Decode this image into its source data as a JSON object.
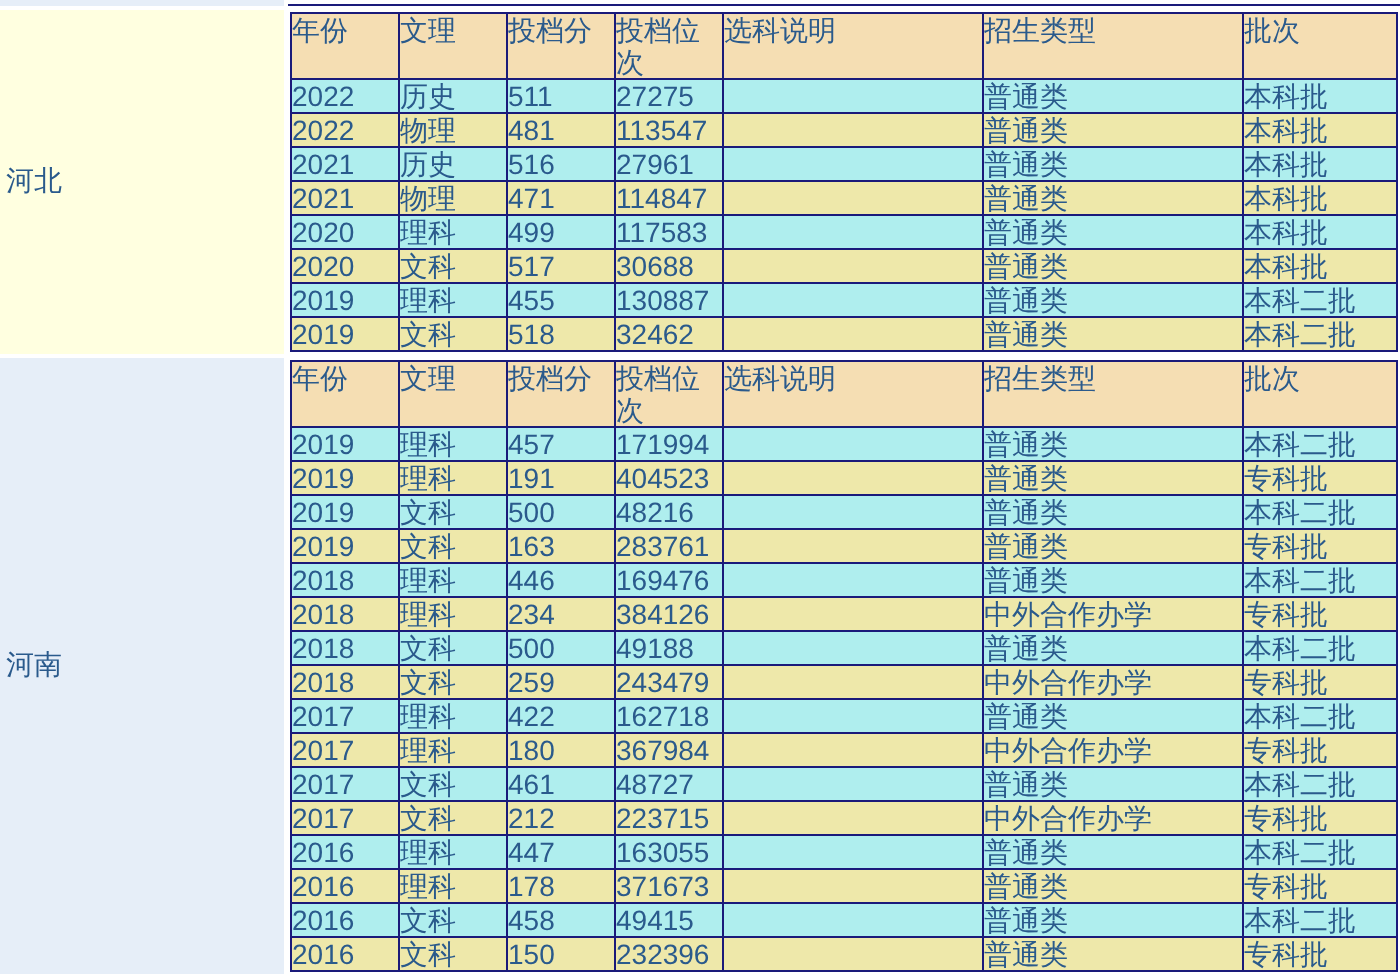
{
  "provinces": [
    {
      "name": "河北",
      "columns": [
        "年份",
        "文理",
        "投档分",
        "投档位次",
        "选科说明",
        "招生类型",
        "批次"
      ],
      "rows": [
        {
          "year": "2022",
          "subject": "历史",
          "score": "511",
          "rank": "27275",
          "type": "普通类",
          "batch": "本科批"
        },
        {
          "year": "2022",
          "subject": "物理",
          "score": "481",
          "rank": "113547",
          "type": "普通类",
          "batch": "本科批"
        },
        {
          "year": "2021",
          "subject": "历史",
          "score": "516",
          "rank": "27961",
          "type": "普通类",
          "batch": "本科批"
        },
        {
          "year": "2021",
          "subject": "物理",
          "score": "471",
          "rank": "114847",
          "type": "普通类",
          "batch": "本科批"
        },
        {
          "year": "2020",
          "subject": "理科",
          "score": "499",
          "rank": "117583",
          "type": "普通类",
          "batch": "本科批"
        },
        {
          "year": "2020",
          "subject": "文科",
          "score": "517",
          "rank": "30688",
          "type": "普通类",
          "batch": "本科批"
        },
        {
          "year": "2019",
          "subject": "理科",
          "score": "455",
          "rank": "130887",
          "type": "普通类",
          "batch": "本科二批"
        },
        {
          "year": "2019",
          "subject": "文科",
          "score": "518",
          "rank": "32462",
          "type": "普通类",
          "batch": "本科二批"
        }
      ]
    },
    {
      "name": "河南",
      "columns": [
        "年份",
        "文理",
        "投档分",
        "投档位次",
        "选科说明",
        "招生类型",
        "批次"
      ],
      "rows": [
        {
          "year": "2019",
          "subject": "理科",
          "score": "457",
          "rank": "171994",
          "type": "普通类",
          "batch": "本科二批"
        },
        {
          "year": "2019",
          "subject": "理科",
          "score": "191",
          "rank": "404523",
          "type": "普通类",
          "batch": "专科批"
        },
        {
          "year": "2019",
          "subject": "文科",
          "score": "500",
          "rank": "48216",
          "type": "普通类",
          "batch": "本科二批"
        },
        {
          "year": "2019",
          "subject": "文科",
          "score": "163",
          "rank": "283761",
          "type": "普通类",
          "batch": "专科批"
        },
        {
          "year": "2018",
          "subject": "理科",
          "score": "446",
          "rank": "169476",
          "type": "普通类",
          "batch": "本科二批"
        },
        {
          "year": "2018",
          "subject": "理科",
          "score": "234",
          "rank": "384126",
          "type": "中外合作办学",
          "batch": "专科批"
        },
        {
          "year": "2018",
          "subject": "文科",
          "score": "500",
          "rank": "49188",
          "type": "普通类",
          "batch": "本科二批"
        },
        {
          "year": "2018",
          "subject": "文科",
          "score": "259",
          "rank": "243479",
          "type": "中外合作办学",
          "batch": "专科批"
        },
        {
          "year": "2017",
          "subject": "理科",
          "score": "422",
          "rank": "162718",
          "type": "普通类",
          "batch": "本科二批"
        },
        {
          "year": "2017",
          "subject": "理科",
          "score": "180",
          "rank": "367984",
          "type": "中外合作办学",
          "batch": "专科批"
        },
        {
          "year": "2017",
          "subject": "文科",
          "score": "461",
          "rank": "48727",
          "type": "普通类",
          "batch": "本科二批"
        },
        {
          "year": "2017",
          "subject": "文科",
          "score": "212",
          "rank": "223715",
          "type": "中外合作办学",
          "batch": "专科批"
        },
        {
          "year": "2016",
          "subject": "理科",
          "score": "447",
          "rank": "163055",
          "type": "普通类",
          "batch": "本科二批"
        },
        {
          "year": "2016",
          "subject": "理科",
          "score": "178",
          "rank": "371673",
          "type": "普通类",
          "batch": "专科批"
        },
        {
          "year": "2016",
          "subject": "文科",
          "score": "458",
          "rank": "49415",
          "type": "普通类",
          "batch": "本科二批"
        },
        {
          "year": "2016",
          "subject": "文科",
          "score": "150",
          "rank": "232396",
          "type": "普通类",
          "batch": "专科批"
        }
      ]
    }
  ]
}
